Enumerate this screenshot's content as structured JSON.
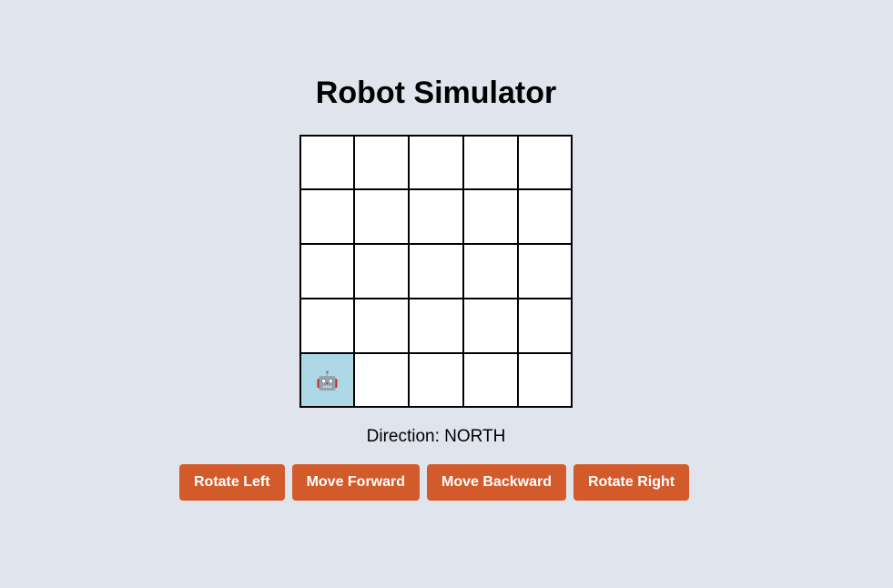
{
  "page": {
    "title": "Robot Simulator"
  },
  "grid": {
    "rows": 5,
    "columns": 5,
    "robot_position": {
      "row": 5,
      "column": 1
    },
    "robot_icon": "robot-icon",
    "robot_glyph": "🤖"
  },
  "status": {
    "direction_label": "Direction:",
    "direction_value": "NORTH",
    "direction_text": "Direction: NORTH"
  },
  "controls": {
    "rotate_left_label": "Rotate Left",
    "move_forward_label": "Move Forward",
    "move_backward_label": "Move Backward",
    "rotate_right_label": "Rotate Right"
  },
  "colors": {
    "background": "#e0e4ed",
    "cell": "#ffffff",
    "robot_cell": "#add8e6",
    "button": "#d35b2b",
    "button_text": "#ffffff"
  }
}
